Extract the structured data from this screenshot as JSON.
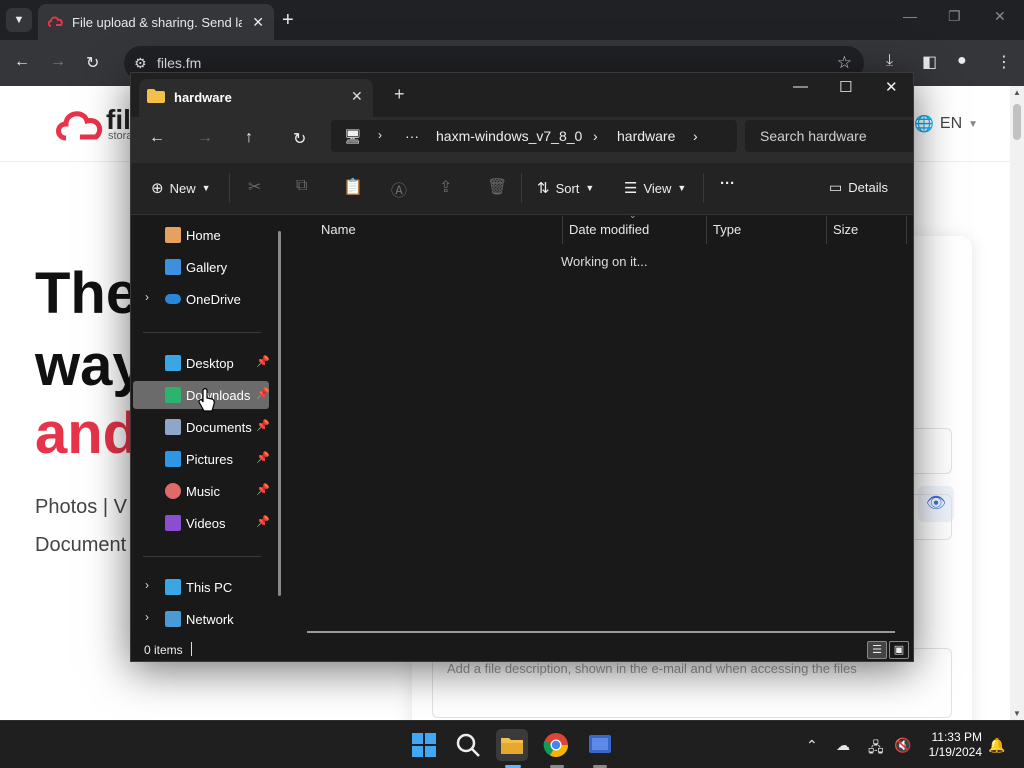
{
  "chrome": {
    "tab_title": "File upload & sharing. Send large files",
    "url": "files.fm",
    "new_tab": "+",
    "close": "✕",
    "minimize": "—",
    "restore": "❐"
  },
  "website": {
    "logo_text": "files",
    "logo_sub": "storage",
    "lang": "EN",
    "hero_line1": "The",
    "hero_line2": "way",
    "hero_line3": "and",
    "hero_types": "Photos  |  V",
    "hero_types2": "Document",
    "desc_placeholder": "Add a file description, shown in the e-mail and when accessing the files"
  },
  "explorer": {
    "tab_title": "hardware",
    "tab_close": "✕",
    "new_tab": "+",
    "breadcrumb_more": "···",
    "breadcrumb": [
      "haxm-windows_v7_8_0",
      "hardware"
    ],
    "search_placeholder": "Search hardware",
    "commands": {
      "new": "New",
      "sort": "Sort",
      "view": "View",
      "more": "···",
      "details": "Details"
    },
    "sidebar": {
      "items": [
        {
          "label": "Home"
        },
        {
          "label": "Gallery"
        },
        {
          "label": "OneDrive"
        },
        {
          "label": "Desktop"
        },
        {
          "label": "Downloads"
        },
        {
          "label": "Documents"
        },
        {
          "label": "Pictures"
        },
        {
          "label": "Music"
        },
        {
          "label": "Videos"
        },
        {
          "label": "This PC"
        },
        {
          "label": "Network"
        }
      ]
    },
    "columns": [
      "Name",
      "Date modified",
      "Type",
      "Size"
    ],
    "loading_text": "Working on it...",
    "status_count": "0 items"
  },
  "taskbar": {
    "time": "11:33 PM",
    "date": "1/19/2024"
  },
  "colors": {
    "brand_red": "#e8334a",
    "explorer_bg": "#191919",
    "selection": "#6b6b6b",
    "accent_blue": "#3b6fd6"
  }
}
